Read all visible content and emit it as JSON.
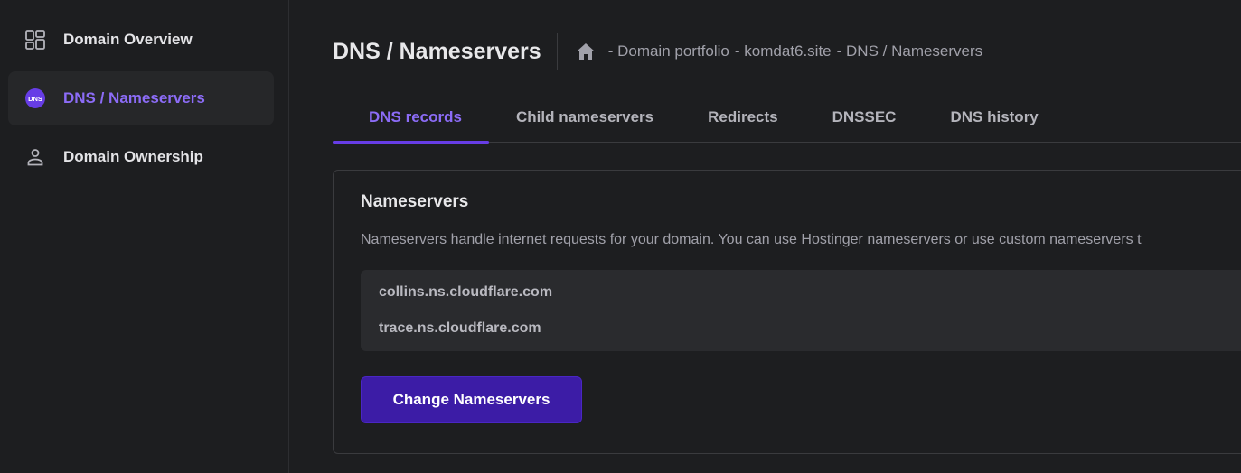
{
  "sidebar": {
    "items": [
      {
        "label": "Domain Overview",
        "icon": "grid-icon",
        "active": false
      },
      {
        "label": "DNS / Nameservers",
        "icon": "dns-icon",
        "active": true,
        "icon_text": "DNS"
      },
      {
        "label": "Domain Ownership",
        "icon": "person-icon",
        "active": false
      }
    ]
  },
  "header": {
    "title": "DNS / Nameservers",
    "breadcrumb": [
      "- Domain portfolio",
      "- komdat6.site",
      "- DNS / Nameservers"
    ]
  },
  "tabs": [
    {
      "label": "DNS records",
      "active": true
    },
    {
      "label": "Child nameservers",
      "active": false
    },
    {
      "label": "Redirects",
      "active": false
    },
    {
      "label": "DNSSEC",
      "active": false
    },
    {
      "label": "DNS history",
      "active": false
    }
  ],
  "nameservers_card": {
    "title": "Nameservers",
    "description": "Nameservers handle internet requests for your domain. You can use Hostinger nameservers or use custom nameservers t",
    "servers": [
      "collins.ns.cloudflare.com",
      "trace.ns.cloudflare.com"
    ],
    "button_label": "Change Nameservers"
  },
  "colors": {
    "accent": "#8c6cf7",
    "button": "#3c1ca6",
    "background": "#1d1e20"
  }
}
